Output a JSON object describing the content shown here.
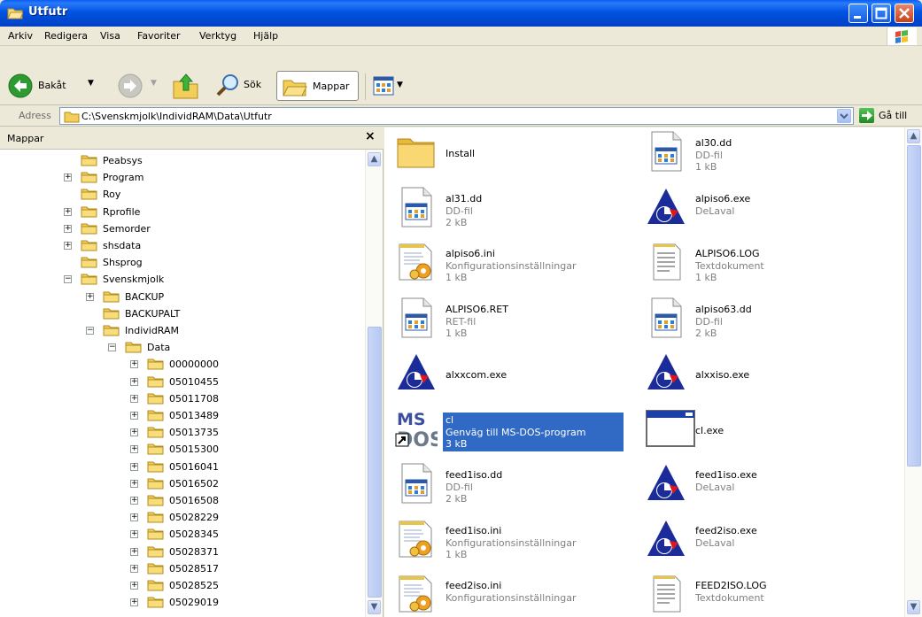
{
  "window": {
    "title": "Utfutr"
  },
  "menu": [
    "Arkiv",
    "Redigera",
    "Visa",
    "Favoriter",
    "Verktyg",
    "Hjälp"
  ],
  "toolbar": {
    "back": "Bakåt",
    "search": "Sök",
    "folders": "Mappar"
  },
  "address": {
    "label": "Adress",
    "path": "C:\\Svenskmjolk\\IndividRAM\\Data\\Utfutr",
    "go": "Gå till"
  },
  "folders_pane": {
    "title": "Mappar"
  },
  "tree": [
    {
      "label": "Peabsys",
      "expander": ""
    },
    {
      "label": "Program",
      "expander": "+"
    },
    {
      "label": "Roy",
      "expander": ""
    },
    {
      "label": "Rprofile",
      "expander": "+"
    },
    {
      "label": "Semorder",
      "expander": "+"
    },
    {
      "label": "shsdata",
      "expander": "+"
    },
    {
      "label": "Shsprog",
      "expander": ""
    },
    {
      "label": "Svenskmjolk",
      "expander": "−"
    },
    {
      "label": "BACKUP",
      "expander": "+"
    },
    {
      "label": "BACKUPALT",
      "expander": ""
    },
    {
      "label": "IndividRAM",
      "expander": "−"
    },
    {
      "label": "Data",
      "expander": "−"
    },
    {
      "label": "00000000",
      "expander": "+"
    },
    {
      "label": "05010455",
      "expander": "+"
    },
    {
      "label": "05011708",
      "expander": "+"
    },
    {
      "label": "05013489",
      "expander": "+"
    },
    {
      "label": "05013735",
      "expander": "+"
    },
    {
      "label": "05015300",
      "expander": "+"
    },
    {
      "label": "05016041",
      "expander": "+"
    },
    {
      "label": "05016502",
      "expander": "+"
    },
    {
      "label": "05016508",
      "expander": "+"
    },
    {
      "label": "05028229",
      "expander": "+"
    },
    {
      "label": "05028345",
      "expander": "+"
    },
    {
      "label": "05028371",
      "expander": "+"
    },
    {
      "label": "05028517",
      "expander": "+"
    },
    {
      "label": "05028525",
      "expander": "+"
    },
    {
      "label": "05029019",
      "expander": "+"
    }
  ],
  "files": [
    {
      "name": "Install",
      "type": "",
      "size": "",
      "icon": "folder-icon"
    },
    {
      "name": "al30.dd",
      "type": "DD-fil",
      "size": "1 kB",
      "icon": "dd-file-icon"
    },
    {
      "name": "al31.dd",
      "type": "DD-fil",
      "size": "2 kB",
      "icon": "dd-file-icon"
    },
    {
      "name": "alpiso6.exe",
      "type": "DeLaval",
      "size": "",
      "icon": "delaval-icon"
    },
    {
      "name": "alpiso6.ini",
      "type": "Konfigurationsinställningar",
      "size": "1 kB",
      "icon": "ini-file-icon"
    },
    {
      "name": "ALPISO6.LOG",
      "type": "Textdokument",
      "size": "1 kB",
      "icon": "text-file-icon"
    },
    {
      "name": "ALPISO6.RET",
      "type": "RET-fil",
      "size": "1 kB",
      "icon": "dd-file-icon"
    },
    {
      "name": "alpiso63.dd",
      "type": "DD-fil",
      "size": "2 kB",
      "icon": "dd-file-icon"
    },
    {
      "name": "alxxcom.exe",
      "type": "",
      "size": "",
      "icon": "delaval-icon"
    },
    {
      "name": "alxxiso.exe",
      "type": "",
      "size": "",
      "icon": "delaval-icon"
    },
    {
      "name": "cl",
      "type": "Genväg till MS-DOS-program",
      "size": "3 kB",
      "icon": "msdos-shortcut-icon",
      "selected": true
    },
    {
      "name": "cl.exe",
      "type": "",
      "size": "",
      "icon": "exe-window-icon"
    },
    {
      "name": "feed1iso.dd",
      "type": "DD-fil",
      "size": "2 kB",
      "icon": "dd-file-icon"
    },
    {
      "name": "feed1iso.exe",
      "type": "DeLaval",
      "size": "",
      "icon": "delaval-icon"
    },
    {
      "name": "feed1iso.ini",
      "type": "Konfigurationsinställningar",
      "size": "1 kB",
      "icon": "ini-file-icon"
    },
    {
      "name": "feed2iso.exe",
      "type": "DeLaval",
      "size": "",
      "icon": "delaval-icon"
    },
    {
      "name": "feed2iso.ini",
      "type": "Konfigurationsinställningar",
      "size": "",
      "icon": "ini-file-icon"
    },
    {
      "name": "FEED2ISO.LOG",
      "type": "Textdokument",
      "size": "",
      "icon": "text-file-icon"
    }
  ]
}
